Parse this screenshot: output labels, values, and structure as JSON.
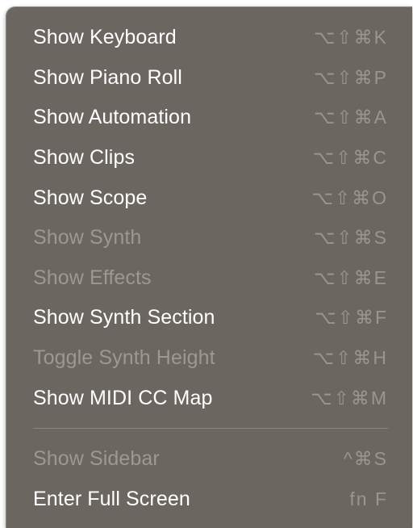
{
  "menu": {
    "items": [
      {
        "label": "Show Keyboard",
        "shortcut": "⌥⇧⌘K",
        "enabled": true
      },
      {
        "label": "Show Piano Roll",
        "shortcut": "⌥⇧⌘P",
        "enabled": true
      },
      {
        "label": "Show Automation",
        "shortcut": "⌥⇧⌘A",
        "enabled": true
      },
      {
        "label": "Show Clips",
        "shortcut": "⌥⇧⌘C",
        "enabled": true
      },
      {
        "label": "Show Scope",
        "shortcut": "⌥⇧⌘O",
        "enabled": true
      },
      {
        "label": "Show Synth",
        "shortcut": "⌥⇧⌘S",
        "enabled": false
      },
      {
        "label": "Show Effects",
        "shortcut": "⌥⇧⌘E",
        "enabled": false
      },
      {
        "label": "Show Synth Section",
        "shortcut": "⌥⇧⌘F",
        "enabled": true
      },
      {
        "label": "Toggle Synth Height",
        "shortcut": "⌥⇧⌘H",
        "enabled": false
      },
      {
        "label": "Show MIDI CC Map",
        "shortcut": "⌥⇧⌘M",
        "enabled": true
      }
    ],
    "items_after_separator": [
      {
        "label": "Show Sidebar",
        "shortcut": "^⌘S",
        "enabled": false
      },
      {
        "label": "Enter Full Screen",
        "shortcut": "fn F",
        "enabled": true
      }
    ]
  },
  "colors": {
    "menu_background": "#6b6660",
    "enabled_text": "#ffffff",
    "disabled_text": "#9d9891",
    "shortcut_text": "#9a958e"
  }
}
